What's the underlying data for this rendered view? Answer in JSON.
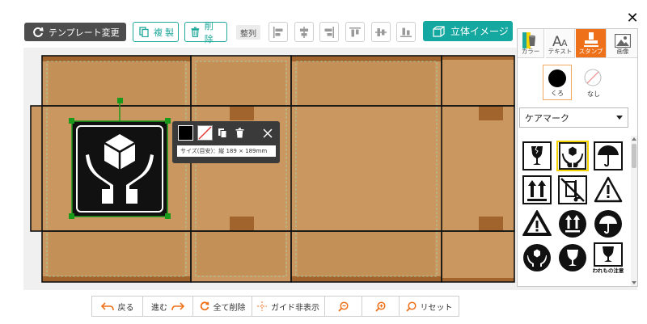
{
  "toolbar": {
    "template_change": "テンプレート変更",
    "duplicate": "複製",
    "delete": "削除",
    "align": "整列",
    "view_3d": "立体イメージ",
    "accent_color": "#14a8a0"
  },
  "context_toolbar": {
    "size_text": "サイズ(目安)：縦 189 × 189mm"
  },
  "panel": {
    "tabs": [
      {
        "label": "カラー",
        "icon": "bucket-icon"
      },
      {
        "label": "テキスト",
        "icon": "text-icon"
      },
      {
        "label": "スタンプ",
        "icon": "stamp-icon"
      },
      {
        "label": "画像",
        "icon": "image-icon"
      }
    ],
    "active_tab": "スタンプ",
    "colors": [
      {
        "label": "くろ",
        "value": "#000000"
      },
      {
        "label": "なし",
        "value": "none"
      }
    ],
    "selected_color": "くろ",
    "category": "ケアマーク",
    "stamps": [
      "fragile-glass-icon",
      "handle-with-care-icon",
      "umbrella-keep-dry-icon",
      "this-side-up-icon",
      "no-hand-truck-icon",
      "warning-icon",
      "warning-circle-icon",
      "this-side-up-circle-icon",
      "umbrella-circle-icon",
      "handle-with-care-circle-icon",
      "fragile-circle-icon",
      "fragile-labeled-icon"
    ],
    "stamp_caption": "われもの注意",
    "selected_stamp_index": 1
  },
  "bottom_bar": {
    "back": "戻る",
    "forward": "進む",
    "clear_all": "全て削除",
    "guide_hide": "ガイド非表示",
    "reset": "リセット"
  },
  "colors": {
    "cardboard": "#c9975f",
    "cardboard_dark": "#a0642c",
    "brand_orange": "#ee7019",
    "selection_green": "#1a9a1a"
  }
}
